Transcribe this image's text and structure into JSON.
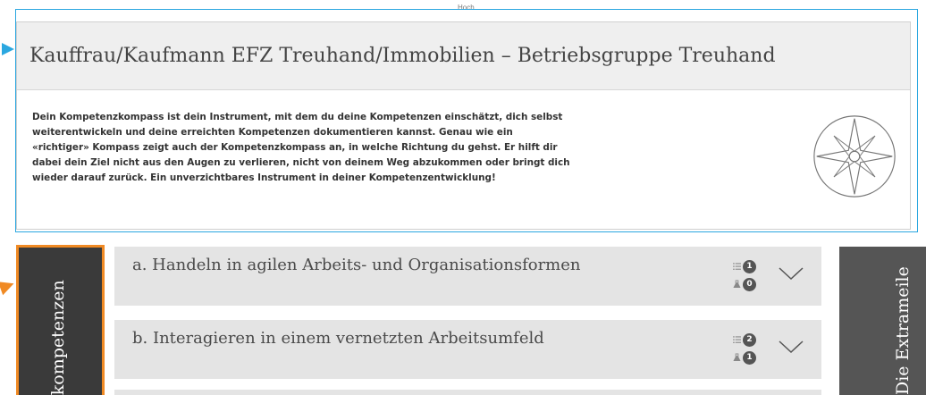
{
  "top_label": "Hoch",
  "header": {
    "title": "Kauffrau/Kaufmann EFZ Treuhand/Immobilien – Betriebsgruppe Treuhand"
  },
  "intro": {
    "lines": [
      "Dein Kompetenzkompass ist dein Instrument, mit dem du deine Kompetenzen einschätzt, dich selbst",
      "weiterentwickeln und deine erreichten Kompetenzen dokumentieren kannst. Genau wie ein",
      "«richtiger» Kompass zeigt auch der Kompetenzkompass an, in welche Richtung du gehst. Er hilft dir",
      "dabei dein Ziel nicht aus den Augen zu verlieren, nicht von deinem Weg abzukommen oder bringt dich",
      "wieder darauf zurück. Ein unverzichtbares Instrument in deiner Kompetenzentwicklung!"
    ],
    "icon": "compass-icon"
  },
  "left_tab": {
    "label": "skompetenzen"
  },
  "right_tab": {
    "label": "Die Extrameile"
  },
  "accordion": [
    {
      "title": "a. Handeln in agilen Arbeits- und Organisationsformen",
      "list_count": "1",
      "lab_count": "0"
    },
    {
      "title": "b. Interagieren in einem vernetzten Arbeitsumfeld",
      "list_count": "2",
      "lab_count": "1"
    }
  ],
  "colors": {
    "highlight_blue": "#2aa7e0",
    "highlight_orange": "#f08a24",
    "tab_dark": "#3a3a3a",
    "tab_grey": "#555555",
    "accordion_bg": "#e4e4e4"
  }
}
